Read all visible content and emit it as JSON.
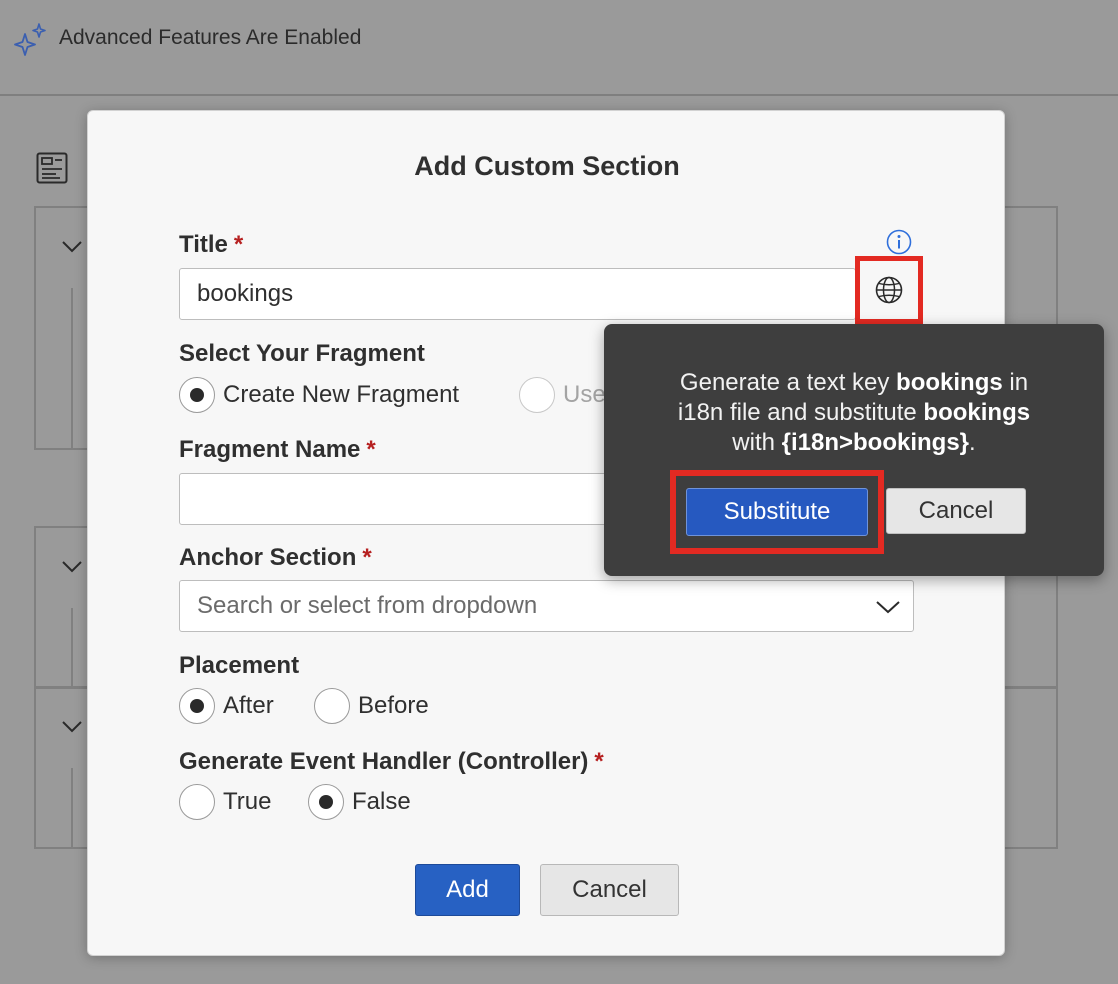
{
  "banner": {
    "text": "Advanced Features Are Enabled"
  },
  "dialog": {
    "title": "Add Custom Section",
    "title_field": {
      "label": "Title",
      "required": "*",
      "value": "bookings"
    },
    "fragment_select": {
      "label": "Select Your Fragment",
      "options": [
        {
          "label": "Create New Fragment",
          "selected": true
        },
        {
          "label": "Use",
          "selected": false
        }
      ]
    },
    "fragment_name": {
      "label": "Fragment Name",
      "required": "*",
      "value": ""
    },
    "anchor_section": {
      "label": "Anchor Section",
      "required": "*",
      "placeholder": "Search or select from dropdown"
    },
    "placement": {
      "label": "Placement",
      "options": [
        {
          "label": "After",
          "selected": true
        },
        {
          "label": "Before",
          "selected": false
        }
      ]
    },
    "event_handler": {
      "label": "Generate Event Handler (Controller)",
      "required": "*",
      "options": [
        {
          "label": "True",
          "selected": false
        },
        {
          "label": "False",
          "selected": true
        }
      ]
    },
    "add_label": "Add",
    "cancel_label": "Cancel"
  },
  "popover": {
    "line1_pre": "Generate a text key ",
    "key": "bookings",
    "line1_post": " in",
    "line2_pre": "i18n file and substitute ",
    "line3_pre": "with ",
    "binding": "{i18n>bookings}",
    "line3_post": ".",
    "substitute_label": "Substitute",
    "cancel_label": "Cancel"
  },
  "colors": {
    "primary": "#2761c3",
    "highlight": "#e32a22",
    "popover_bg": "#3e3e3e",
    "required": "#b62020"
  },
  "icons": [
    "sparkle-icon",
    "outline-icon",
    "info-icon",
    "globe-icon",
    "chevron-down-icon"
  ]
}
